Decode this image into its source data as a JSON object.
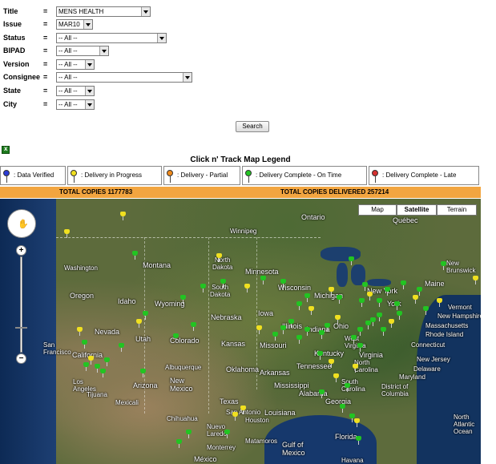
{
  "form": {
    "fields": [
      {
        "label": "Title",
        "eq": "=",
        "value": "MENS HEALTH"
      },
      {
        "label": "Issue",
        "eq": "=",
        "value": "MAR10"
      },
      {
        "label": "Status",
        "eq": "=",
        "value": "-- All --"
      },
      {
        "label": "BIPAD",
        "eq": "=",
        "value": "-- All --"
      },
      {
        "label": "Version",
        "eq": "=",
        "value": "-- All --"
      },
      {
        "label": "Consignee",
        "eq": "=",
        "value": "-- All --"
      },
      {
        "label": "State",
        "eq": "=",
        "value": "-- All --"
      },
      {
        "label": "City",
        "eq": "=",
        "value": "-- All --"
      }
    ],
    "search_label": "Search"
  },
  "legend": {
    "title": "Click n' Track Map Legend",
    "items": [
      {
        "label": ": Data Verified",
        "color": "#2b3cd6"
      },
      {
        "label": ": Delivery in Progress",
        "color": "#f0e020"
      },
      {
        "label": ": Delivery - Partial",
        "color": "#f08a1a"
      },
      {
        "label": ": Delivery Complete - On Time",
        "color": "#22c422"
      },
      {
        "label": ": Delivery Complete - Late",
        "color": "#d43030"
      }
    ]
  },
  "totals": {
    "copies": "TOTAL COPIES 1177783",
    "delivered": "TOTAL COPIES DELIVERED 257214"
  },
  "map": {
    "types": [
      "Map",
      "Satellite",
      "Terrain"
    ],
    "active_type": "Satellite",
    "labels": {
      "ontario": "Ontario",
      "quebec": "Québec",
      "winnipeg": "Winnipeg",
      "washington": "Washington",
      "montana": "Montana",
      "north_dakota": "North\nDakota",
      "minnesota": "Minnesota",
      "south_dakota": "South\nDakota",
      "wisconsin": "Wisconsin",
      "michigan": "Michigan",
      "new_york": "New York",
      "maine": "Maine",
      "new_brunswick": "New\nBrunswick",
      "oregon": "Oregon",
      "idaho": "Idaho",
      "wyoming": "Wyoming",
      "nebraska": "Nebraska",
      "iowa": "Iowa",
      "illinois": "Illinois",
      "indiana": "Indiana",
      "ohio": "Ohio",
      "vermont": "Vermont",
      "new_hampshire": "New Hampshire",
      "massachusetts": "Massachusetts",
      "rhode_island": "Rhode Island",
      "connecticut": "Connecticut",
      "nevada": "Nevada",
      "utah": "Utah",
      "colorado": "Colorado",
      "kansas": "Kansas",
      "missouri": "Missouri",
      "west_virginia": "West\nVirginia",
      "virginia": "Virginia",
      "kentucky": "Kentucky",
      "new_jersey": "New Jersey",
      "delaware": "Delaware",
      "maryland": "Maryland",
      "san_francisco": "San\nFrancisco",
      "california": "California",
      "oklahoma": "Oklahoma",
      "arkansas": "Arkansas",
      "tennessee": "Tennessee",
      "north_carolina": "North\nCarolina",
      "district_of_columbia": "District of\nColumbia",
      "los_angeles": "Los\nAngeles",
      "arizona": "Arizona",
      "new_mexico": "New\nMexico",
      "albuquerque": "Albuquerque",
      "mississippi": "Mississippi",
      "alabama": "Alabama",
      "georgia": "Georgia",
      "south_carolina": "South\nCarolina",
      "tijuana": "Tijuana",
      "mexicali": "Mexicali",
      "texas": "Texas",
      "houston": "Houston",
      "louisiana": "Louisiana",
      "chihuahua": "Chihuahua",
      "nuevo_laredo": "Nuevo\nLaredo",
      "matamoros": "Matamoros",
      "gulf_of_mexico": "Gulf of\nMexico",
      "florida": "Florida",
      "north_atlantic": "North\nAtlantic\nOcean",
      "mexico": "México",
      "havana": "Havana",
      "monterrey": "Monterrey",
      "san_antonio": "San Antonio",
      "york": "York",
      "atlantic_city": "Atlantic"
    }
  }
}
